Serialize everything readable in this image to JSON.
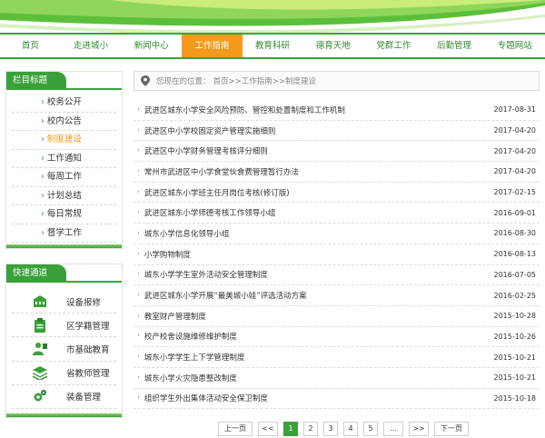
{
  "nav": {
    "items": [
      "首页",
      "走进城小",
      "新闻中心",
      "工作指南",
      "教育科研",
      "德育天地",
      "党群工作",
      "后勤管理",
      "专题网站"
    ],
    "active_index": 3
  },
  "sidebar": {
    "title": "栏目标题",
    "items": [
      "校务公开",
      "校内公告",
      "制度建设",
      "工作通知",
      "每周工作",
      "计划总结",
      "每日常规",
      "督学工作"
    ],
    "current_index": 2
  },
  "quick": {
    "title": "快速通道",
    "items": [
      {
        "label": "设备报修",
        "icon": "building-icon"
      },
      {
        "label": "区学籍管理",
        "icon": "clipboard-icon"
      },
      {
        "label": "市基础教育",
        "icon": "teacher-icon"
      },
      {
        "label": "省教师管理",
        "icon": "layers-icon"
      },
      {
        "label": "装备管理",
        "icon": "gears-icon"
      }
    ]
  },
  "breadcrumb": {
    "label": "您现在的位置：",
    "path": "首页>>工作指南>>制度建设"
  },
  "articles": [
    {
      "title": "武进区城东小学安全风险预防、管控和处置制度和工作机制",
      "date": "2017-08-31"
    },
    {
      "title": "武进区中小学校固定资产管理实施细则",
      "date": "2017-04-20"
    },
    {
      "title": "武进区中小学财务管理考核评分细则",
      "date": "2017-04-20"
    },
    {
      "title": "常州市武进区中小学食堂伙食费管理暂行办法",
      "date": "2017-04-20"
    },
    {
      "title": "武进区城东小学班主任月岗位考核(修订版)",
      "date": "2017-02-15"
    },
    {
      "title": "武进区城东小学师德考核工作领导小组",
      "date": "2016-09-01"
    },
    {
      "title": "城东小学信息化领导小组",
      "date": "2016-08-30"
    },
    {
      "title": "小学购物制度",
      "date": "2016-08-13"
    },
    {
      "title": "城东小学学生室外活动安全管理制度",
      "date": "2016-07-05"
    },
    {
      "title": "武进区城东小学开展“最美城小娃”评选活动方案",
      "date": "2016-02-25"
    },
    {
      "title": "教室财产管理制度",
      "date": "2015-10-28"
    },
    {
      "title": "校产校舍设施维修维护制度",
      "date": "2015-10-26"
    },
    {
      "title": "城东小学学生上下学管理制度",
      "date": "2015-10-21"
    },
    {
      "title": "城东小学火灾隐患整改制度",
      "date": "2015-10-21"
    },
    {
      "title": "组织学生外出集体活动安全保卫制度",
      "date": "2015-10-18"
    }
  ],
  "pagination": {
    "prev": "上一页",
    "first": "<<",
    "pages": [
      "1",
      "2",
      "3",
      "4",
      "5"
    ],
    "current": "1",
    "ellipsis": "...",
    "last": ">>",
    "next": "下一页"
  },
  "colors": {
    "brand_green": "#3aa13a",
    "accent_orange": "#f39a1d"
  }
}
